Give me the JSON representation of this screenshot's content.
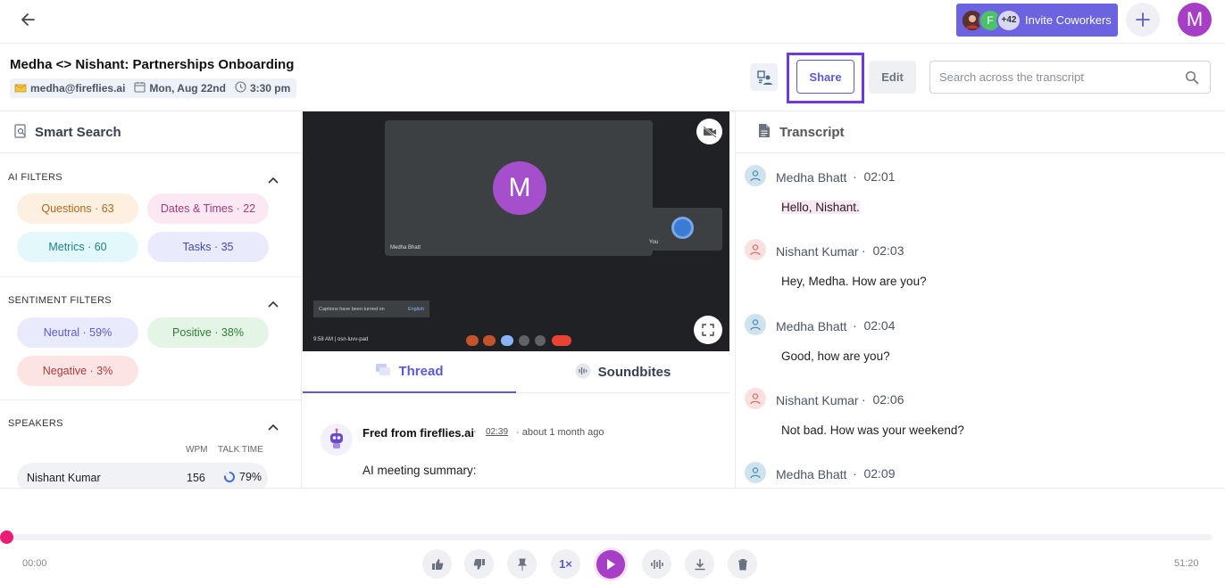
{
  "topbar": {
    "invite_label": "Invite Coworkers",
    "avatar_count": "+42",
    "avatar_letter": "F",
    "user_initial": "M"
  },
  "meeting": {
    "title": "Medha <> Nishant: Partnerships Onboarding",
    "email": "medha@fireflies.ai",
    "date": "Mon, Aug 22nd",
    "time": "3:30 pm"
  },
  "actions": {
    "share_label": "Share",
    "edit_label": "Edit",
    "search_placeholder": "Search across the transcript"
  },
  "smart_search": {
    "title": "Smart Search",
    "ai_filters_title": "AI FILTERS",
    "ai_filters": [
      {
        "label": "Questions · 63",
        "bg": "#fdf0e0",
        "fg": "#b06a1e"
      },
      {
        "label": "Dates & Times · 22",
        "bg": "#fce8f3",
        "fg": "#a23b7a"
      },
      {
        "label": "Metrics · 60",
        "bg": "#e3f8fa",
        "fg": "#1f7f8a"
      },
      {
        "label": "Tasks · 35",
        "bg": "#e9eafb",
        "fg": "#454aa8"
      }
    ],
    "sentiment_title": "SENTIMENT FILTERS",
    "sentiment_filters": [
      {
        "label": "Neutral · 59%",
        "bg": "#e9eafb",
        "fg": "#5b5bd6"
      },
      {
        "label": "Positive · 38%",
        "bg": "#e4f5e6",
        "fg": "#2e7d32"
      },
      {
        "label": "Negative · 3%",
        "bg": "#fde4e4",
        "fg": "#b23a3a"
      }
    ],
    "speakers_title": "SPEAKERS",
    "wpm_header": "WPM",
    "talk_header": "TALK TIME",
    "speakers": [
      {
        "name": "Nishant Kumar",
        "wpm": "156",
        "talk": "79%",
        "talk_fraction": 0.79
      }
    ]
  },
  "video": {
    "participant_initial": "M",
    "participant_name": "Medha Bhatt",
    "self_label": "You",
    "captions_text": "Captions have been turned on",
    "captions_lang": "English",
    "clock": "9:58 AM  |  osn-luvv-pad"
  },
  "thread": {
    "tab_thread": "Thread",
    "tab_soundbites": "Soundbites",
    "author": "Fred from fireflies.ai",
    "timestamp": "02:39",
    "ago": "about 1 month ago",
    "message": "AI meeting summary:"
  },
  "transcript": {
    "title": "Transcript",
    "entries": [
      {
        "speaker": "Medha Bhatt",
        "time": "02:01",
        "text": "Hello, Nishant.",
        "color": "blue",
        "highlight": true
      },
      {
        "speaker": "Nishant Kumar",
        "time": "02:03",
        "text": "Hey, Medha. How are you?",
        "color": "red",
        "highlight": false
      },
      {
        "speaker": "Medha Bhatt",
        "time": "02:04",
        "text": "Good, how are you?",
        "color": "blue",
        "highlight": false
      },
      {
        "speaker": "Nishant Kumar",
        "time": "02:06",
        "text": "Not bad. How was your weekend?",
        "color": "red",
        "highlight": false
      },
      {
        "speaker": "Medha Bhatt",
        "time": "02:09",
        "text": "",
        "color": "blue",
        "highlight": false
      }
    ]
  },
  "player": {
    "current": "00:00",
    "duration": "51:20",
    "speed": "1×",
    "progress_fraction": 0.0
  },
  "colors": {
    "accent": "#5b5bd6",
    "brand_purple": "#a63ec6",
    "progress": "#ec1c75",
    "share_highlight": "#6e39e0"
  }
}
